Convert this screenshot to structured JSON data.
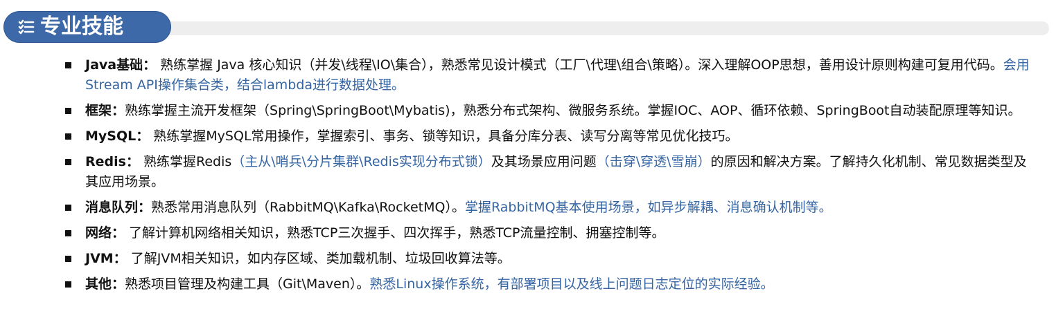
{
  "section": {
    "title": "专业技能",
    "icon": "checklist-icon",
    "accent_color": "#3d69a8",
    "bar_color": "#eeeeee"
  },
  "skills": [
    {
      "label": "Java基础：",
      "text": " 熟练掌握 Java 核心知识（并发\\线程\\IO\\集合），熟悉常见设计模式（工厂\\代理\\组合\\策略）。深入理解OOP思想，善用设计原则构建可复用代码。",
      "highlight": "会用Stream API操作集合类，结合lambda进行数据处理。",
      "tail": "",
      "highlight2": "",
      "tail2": ""
    },
    {
      "label": "框架：",
      "text": "熟练掌握主流开发框架（Spring\\SpringBoot\\Mybatis)，熟悉分布式架构、微服务系统。掌握IOC、AOP、循环依赖、SpringBoot自动装配原理等知识。",
      "highlight": "",
      "tail": "",
      "highlight2": "",
      "tail2": ""
    },
    {
      "label": "MySQL：",
      "text": " 熟练掌握MySQL常用操作，掌握索引、事务、锁等知识，具备分库分表、读写分离等常见优化技巧。",
      "highlight": "",
      "tail": "",
      "highlight2": "",
      "tail2": ""
    },
    {
      "label": "Redis：",
      "text": " 熟练掌握Redis",
      "highlight": "（主从\\哨兵\\分片集群\\Redis实现分布式锁）",
      "tail": "及其场景应用问题",
      "highlight2": "（击穿\\穿透\\雪崩）",
      "tail2": "的原因和解决方案。了解持久化机制、常见数据类型及其应用场景。"
    },
    {
      "label": "消息队列：",
      "text": "熟悉常用消息队列（RabbitMQ\\Kafka\\RocketMQ）。",
      "highlight": "掌握RabbitMQ基本使用场景，如异步解耦、消息确认机制等。",
      "tail": "",
      "highlight2": "",
      "tail2": ""
    },
    {
      "label": "网络：",
      "text": " 了解计算机网络相关知识，熟悉TCP三次握手、四次挥手，熟悉TCP流量控制、拥塞控制等。",
      "highlight": "",
      "tail": "",
      "highlight2": "",
      "tail2": ""
    },
    {
      "label": "JVM：",
      "text": " 了解JVM相关知识，如内存区域、类加载机制、垃圾回收算法等。",
      "highlight": "",
      "tail": "",
      "highlight2": "",
      "tail2": ""
    },
    {
      "label": "其他：",
      "text": "熟悉项目管理及构建工具（Git\\Maven）。",
      "highlight": "熟悉Linux操作系统，有部署项目以及线上问题日志定位的实际经验。",
      "tail": "",
      "highlight2": "",
      "tail2": ""
    }
  ],
  "colors": {
    "text": "#111111",
    "highlight": "#3565a3"
  }
}
